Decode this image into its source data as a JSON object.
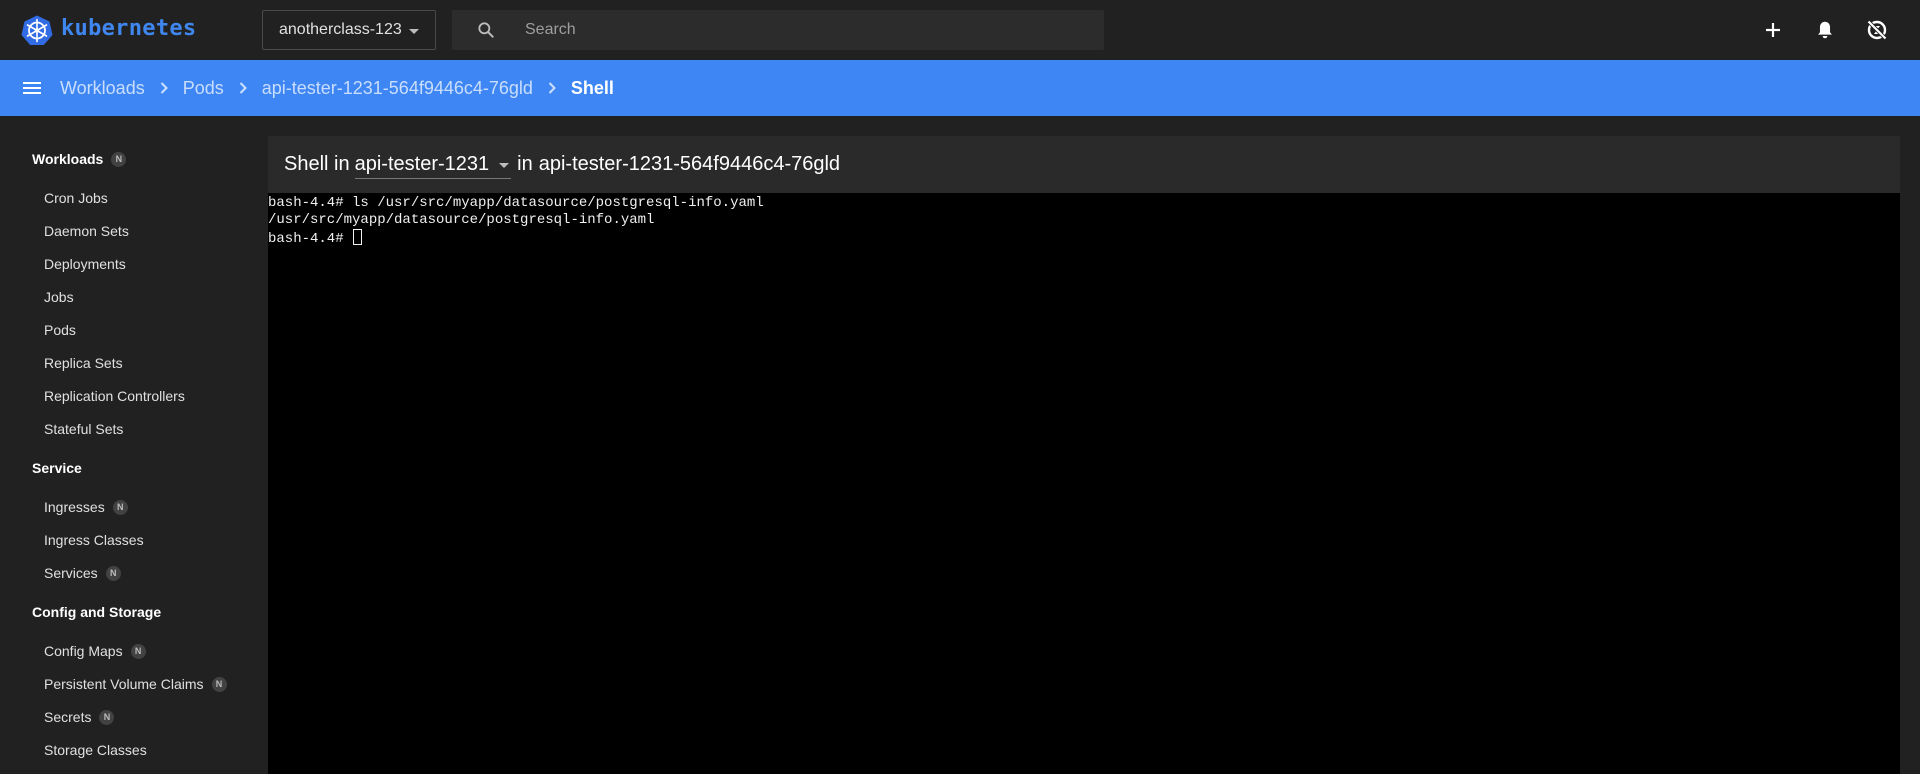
{
  "topbar": {
    "brand": "kubernetes",
    "namespace": "anotherclass-123",
    "search_placeholder": "Search"
  },
  "breadcrumb": [
    "Workloads",
    "Pods",
    "api-tester-1231-564f9446c4-76gld",
    "Shell"
  ],
  "sidebar": {
    "groups": [
      {
        "label": "Workloads",
        "badge": "N",
        "items": [
          {
            "label": "Cron Jobs"
          },
          {
            "label": "Daemon Sets"
          },
          {
            "label": "Deployments"
          },
          {
            "label": "Jobs"
          },
          {
            "label": "Pods"
          },
          {
            "label": "Replica Sets"
          },
          {
            "label": "Replication Controllers"
          },
          {
            "label": "Stateful Sets"
          }
        ]
      },
      {
        "label": "Service",
        "items": [
          {
            "label": "Ingresses",
            "badge": "N"
          },
          {
            "label": "Ingress Classes"
          },
          {
            "label": "Services",
            "badge": "N"
          }
        ]
      },
      {
        "label": "Config and Storage",
        "items": [
          {
            "label": "Config Maps",
            "badge": "N"
          },
          {
            "label": "Persistent Volume Claims",
            "badge": "N"
          },
          {
            "label": "Secrets",
            "badge": "N"
          },
          {
            "label": "Storage Classes"
          }
        ]
      }
    ]
  },
  "shell": {
    "prefix": "Shell in",
    "container": "api-tester-1231",
    "pod_prefix": "in",
    "pod": "api-tester-1231-564f9446c4-76gld"
  },
  "terminal": {
    "lines": [
      "bash-4.4# ls /usr/src/myapp/datasource/postgresql-info.yaml",
      "/usr/src/myapp/datasource/postgresql-info.yaml",
      "bash-4.4# "
    ]
  },
  "colors": {
    "accent": "#3d86f3",
    "brand": "#3f86ef",
    "background": "#212121",
    "terminal_bg": "#000000"
  }
}
